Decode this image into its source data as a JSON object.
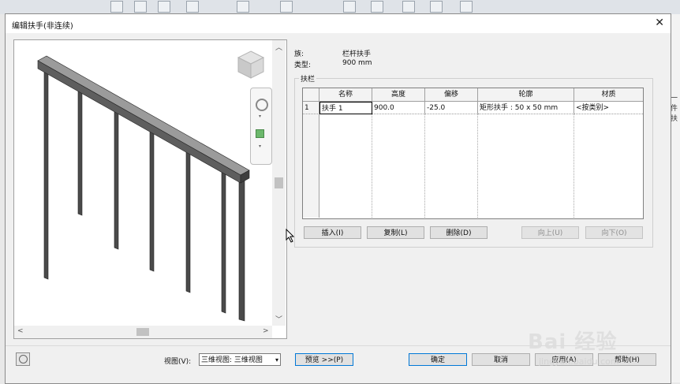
{
  "dialog": {
    "title": "编辑扶手(非连续)",
    "close_glyph": "✕"
  },
  "info": {
    "family_label": "族:",
    "family_value": "栏杆扶手",
    "type_label": "类型:",
    "type_value": "900 mm"
  },
  "group_title": "扶栏",
  "grid": {
    "columns": [
      "名称",
      "高度",
      "偏移",
      "轮廓",
      "材质"
    ],
    "rows": [
      {
        "index": "1",
        "name": "扶手 1",
        "height": "900.0",
        "offset": "-25.0",
        "profile": "矩形扶手 : 50 x 50 mm",
        "material": "<按类别>"
      }
    ]
  },
  "buttons": {
    "insert": "插入(I)",
    "copy": "复制(L)",
    "delete": "删除(D)",
    "up": "向上(U)",
    "down": "向下(O)",
    "preview": "预览 >>(P)",
    "ok": "确定",
    "cancel": "取消",
    "apply": "应用(A)",
    "help": "帮助(H)"
  },
  "view": {
    "label": "视图(V):",
    "selected": "三维视图: 三维视图"
  },
  "background": {
    "right_texts": [
      "一",
      "件",
      "扶"
    ]
  },
  "watermark": {
    "text": "Bai 经验",
    "sub": "jingyan.baidu.com"
  },
  "icons": {
    "viewcube": "viewcube-icon",
    "steering": "steering-wheel-icon",
    "zoom": "zoom-icon",
    "preview_toggle": "preview-toggle-icon"
  }
}
